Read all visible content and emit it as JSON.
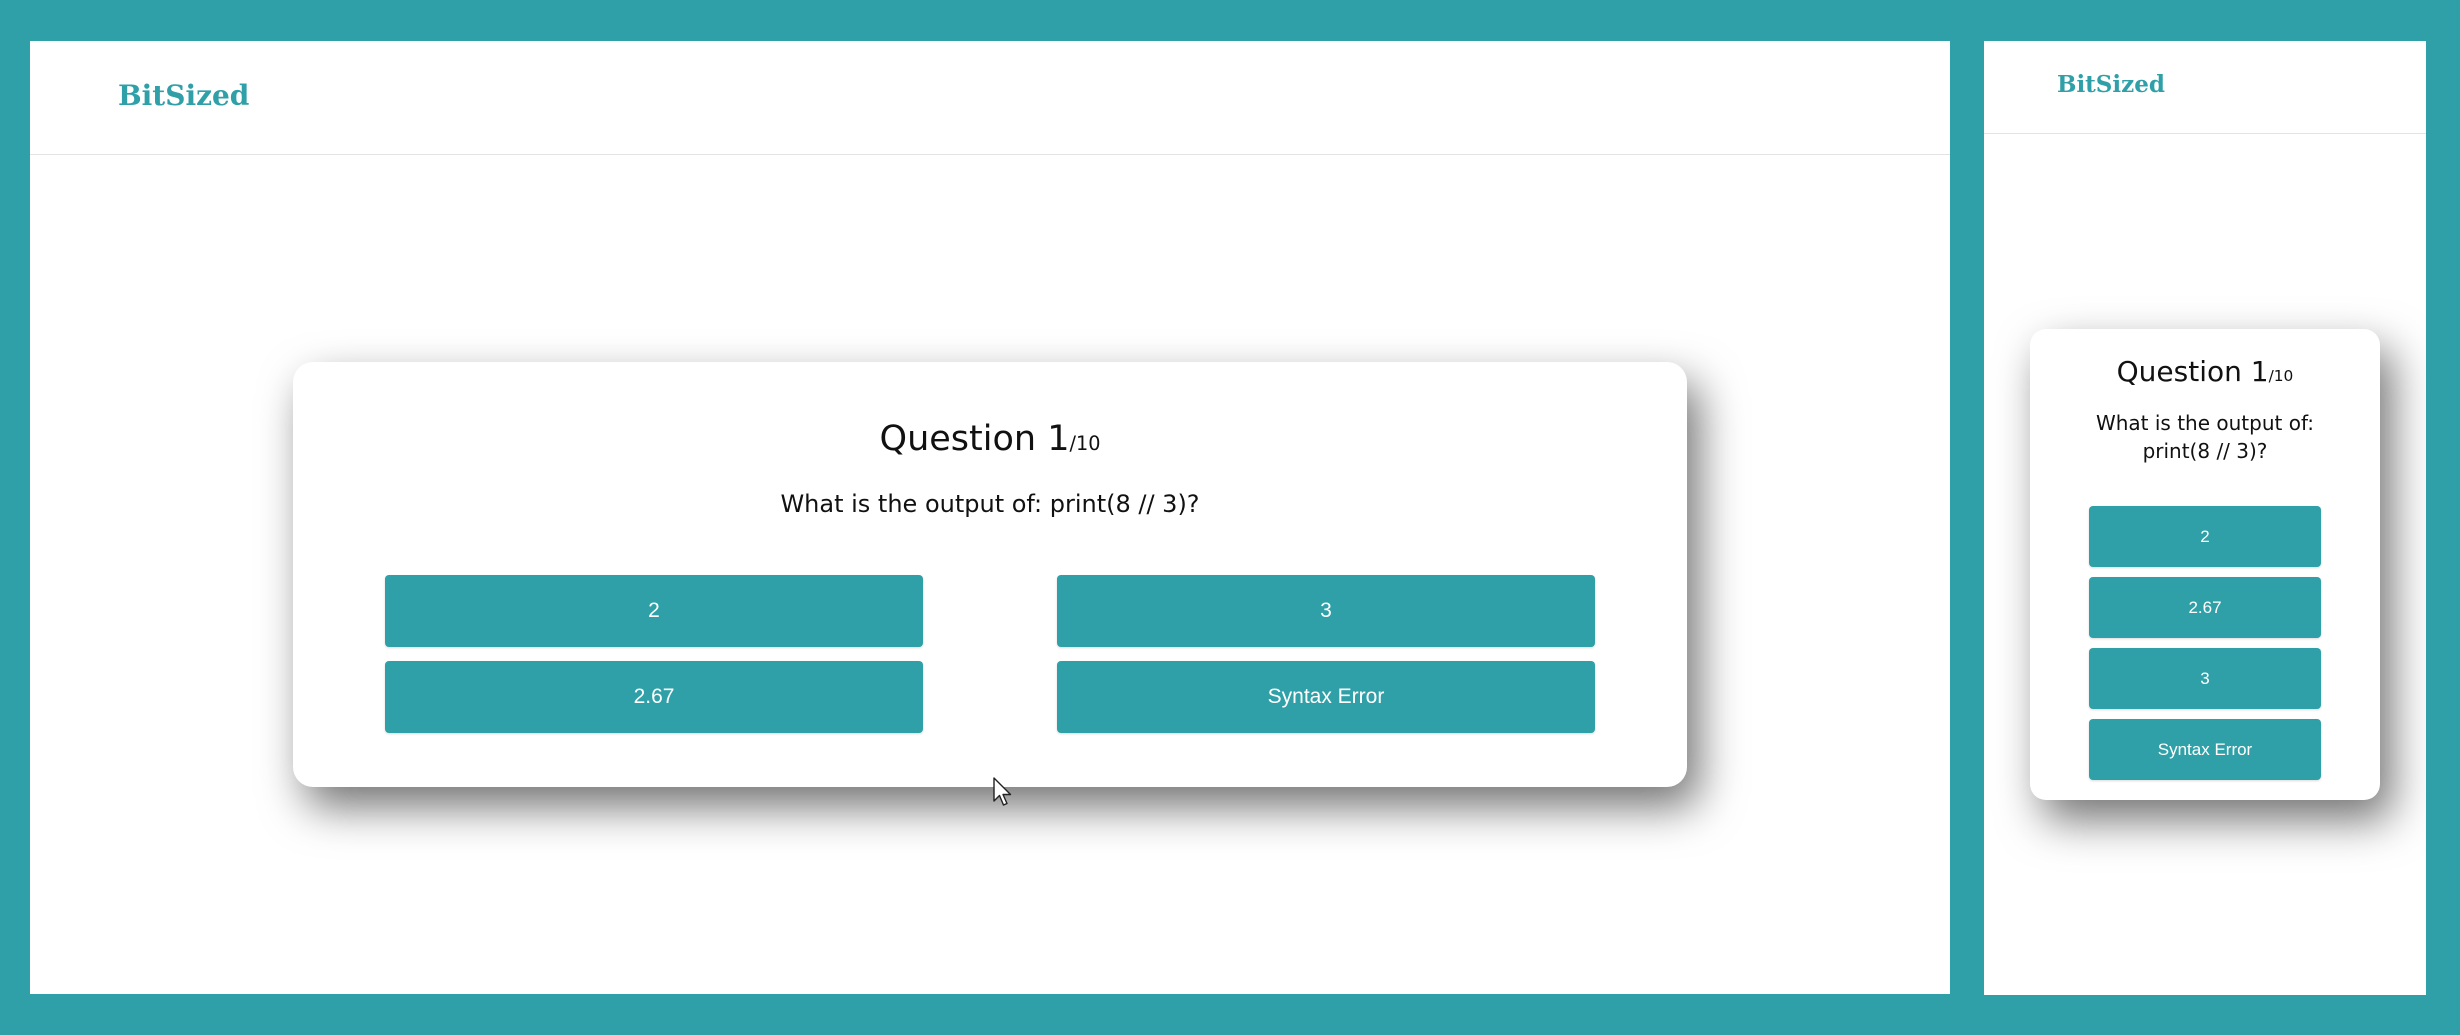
{
  "brand": {
    "name": "BitSized",
    "accent_color": "#30a0a8"
  },
  "desktop": {
    "question": {
      "label": "Question 1",
      "total": "/10",
      "text": "What is the output of: print(8 // 3)?"
    },
    "answers": [
      "2",
      "3",
      "2.67",
      "Syntax Error"
    ]
  },
  "mobile": {
    "question": {
      "label": "Question 1",
      "total": "/10",
      "text": "What is the output of: print(8 // 3)?"
    },
    "answers": [
      "2",
      "2.67",
      "3",
      "Syntax Error"
    ]
  },
  "cursor_icon": "mouse-pointer-icon"
}
